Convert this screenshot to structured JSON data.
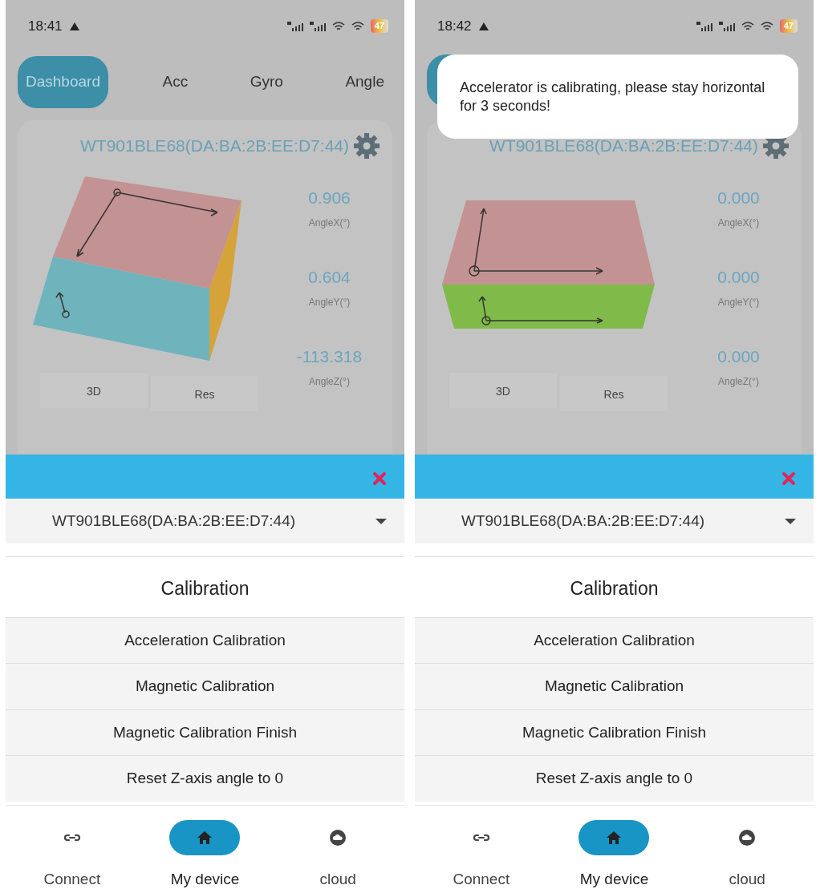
{
  "screens": [
    {
      "status_bar": {
        "time": "18:41",
        "battery": "47"
      },
      "tabs": [
        {
          "label": "Dashboard",
          "selected": true
        },
        {
          "label": "Acc",
          "selected": false
        },
        {
          "label": "Gyro",
          "selected": false
        },
        {
          "label": "Angle",
          "selected": false
        }
      ],
      "card": {
        "device_name": "WT901BLE68(DA:BA:2B:EE:D7:44)",
        "kind": "tilted",
        "readings": [
          {
            "value": "0.906",
            "label": "AngleX(°)"
          },
          {
            "value": "0.604",
            "label": "AngleY(°)"
          },
          {
            "value": "-113.318",
            "label": "AngleZ(°)"
          }
        ],
        "buttons": [
          {
            "label": "3D",
            "kind": "plain"
          },
          {
            "label": "Res",
            "kind": "reset"
          }
        ]
      },
      "sheet": {
        "device_select": "WT901BLE68(DA:BA:2B:EE:D7:44)",
        "title": "Calibration",
        "items": [
          "Acceleration Calibration",
          "Magnetic Calibration",
          "Magnetic Calibration Finish",
          "Reset Z-axis angle to 0"
        ]
      },
      "nav": [
        {
          "label": "Connect",
          "kind": "link",
          "selected": false
        },
        {
          "label": "My device",
          "kind": "home",
          "selected": true
        },
        {
          "label": "cloud",
          "kind": "cloud",
          "selected": false
        }
      ]
    },
    {
      "status_bar": {
        "time": "18:42",
        "battery": "47"
      },
      "toast": "Accelerator is calibrating, please stay horizontal for 3 seconds!",
      "card": {
        "device_name": "WT901BLE68(DA:BA:2B:EE:D7:44)",
        "kind": "flat",
        "readings": [
          {
            "value": "0.000",
            "label": "AngleX(°)"
          },
          {
            "value": "0.000",
            "label": "AngleY(°)"
          },
          {
            "value": "0.000",
            "label": "AngleZ(°)"
          }
        ],
        "buttons": [
          {
            "label": "3D",
            "kind": "plain"
          },
          {
            "label": "Res",
            "kind": "reset"
          }
        ]
      },
      "sheet": {
        "device_select": "WT901BLE68(DA:BA:2B:EE:D7:44)",
        "title": "Calibration",
        "items": [
          "Acceleration Calibration",
          "Magnetic Calibration",
          "Magnetic Calibration Finish",
          "Reset Z-axis angle to 0"
        ]
      },
      "nav": [
        {
          "label": "Connect",
          "kind": "link",
          "selected": false
        },
        {
          "label": "My device",
          "kind": "home",
          "selected": true
        },
        {
          "label": "cloud",
          "kind": "cloud",
          "selected": false
        }
      ]
    }
  ]
}
